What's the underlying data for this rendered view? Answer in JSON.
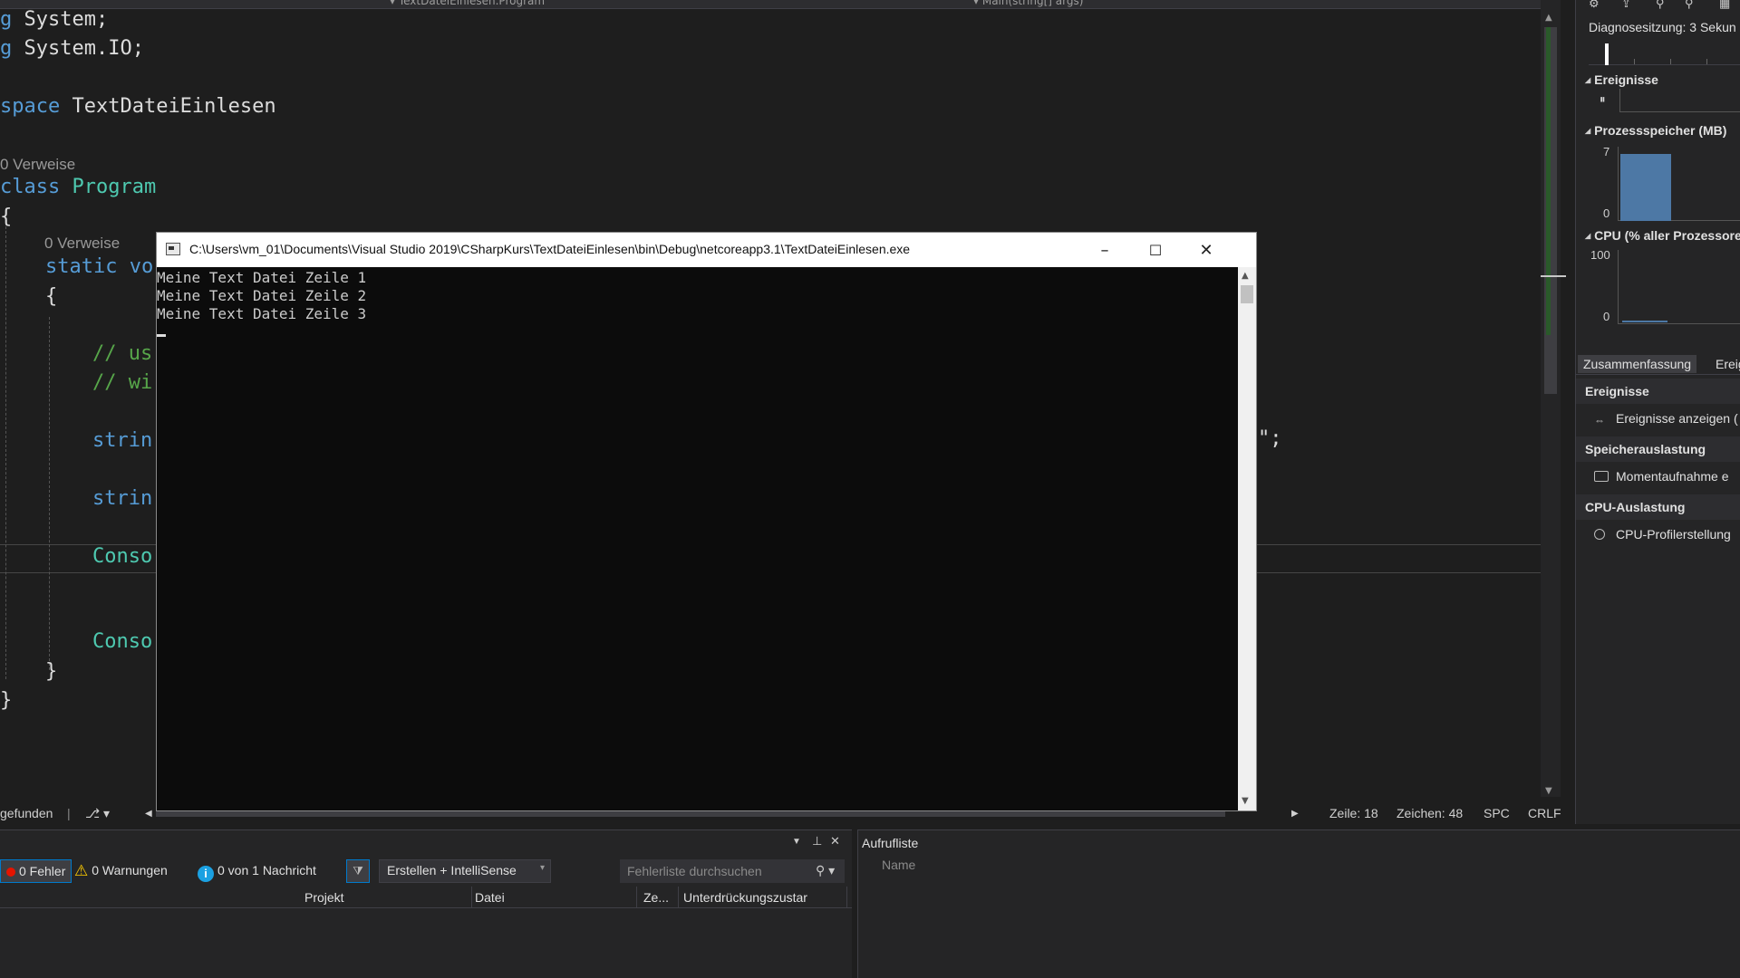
{
  "editor": {
    "code": {
      "l1": {
        "kw": "g",
        "rest": " System;"
      },
      "l2": {
        "kw": "g",
        "rest": " System.IO;"
      },
      "l3": {
        "kw": "space",
        "rest": " TextDateiEinlesen"
      },
      "l4": {
        "kw": "class",
        "type": "Program"
      },
      "l5": "{",
      "l6": {
        "kw": "static",
        "rest": " vo"
      },
      "l7": "{",
      "l8": "// us",
      "l9": "// wi",
      "l10": "strin",
      "l11": "strin",
      "l12": "Conso",
      "l13": "Conso",
      "l14": "}",
      "l15": "}",
      "right_fragment": "\";"
    },
    "codelens_class": "0 Verweise",
    "codelens_method": "0 Verweise",
    "status": {
      "found": "gefunden",
      "line": "Zeile: 18",
      "column": "Zeichen: 48",
      "spc": "SPC",
      "eol": "CRLF"
    }
  },
  "console": {
    "title": "C:\\Users\\vm_01\\Documents\\Visual Studio 2019\\CSharpKurs\\TextDateiEinlesen\\bin\\Debug\\netcoreapp3.1\\TextDateiEinlesen.exe",
    "minimize": "–",
    "maximize": "☐",
    "close": "✕",
    "lines": [
      "Meine Text Datei Zeile 1",
      "Meine Text Datei Zeile 2",
      "Meine Text Datei Zeile 3"
    ]
  },
  "diagnostics": {
    "session": "Diagnosesitzung: 3 Sekun",
    "events_header": "Ereignisse",
    "memory_header": "Prozessspeicher (MB)",
    "memory_max": "7",
    "memory_min": "0",
    "memory_level": 0.9,
    "cpu_header": "CPU (% aller Prozessore",
    "cpu_max": "100",
    "cpu_min": "0",
    "tabs": [
      "Zusammenfassung",
      "Ereig"
    ],
    "sections": {
      "events": "Ereignisse",
      "events_action": "Ereignisse anzeigen (",
      "memory": "Speicherauslastung",
      "memory_action": "Momentaufnahme e",
      "cpu": "CPU-Auslastung",
      "cpu_action": "CPU-Profilerstellung"
    }
  },
  "errorlist": {
    "errors": "0 Fehler",
    "warnings": "0 Warnungen",
    "messages": "0 von 1 Nachricht",
    "scope": "Erstellen + IntelliSense",
    "search_placeholder": "Fehlerliste durchsuchen",
    "columns": [
      "Projekt",
      "Datei",
      "Ze...",
      "Unterdrückungszustar"
    ]
  },
  "callstack": {
    "title": "Aufrufliste",
    "column_name": "Name"
  }
}
